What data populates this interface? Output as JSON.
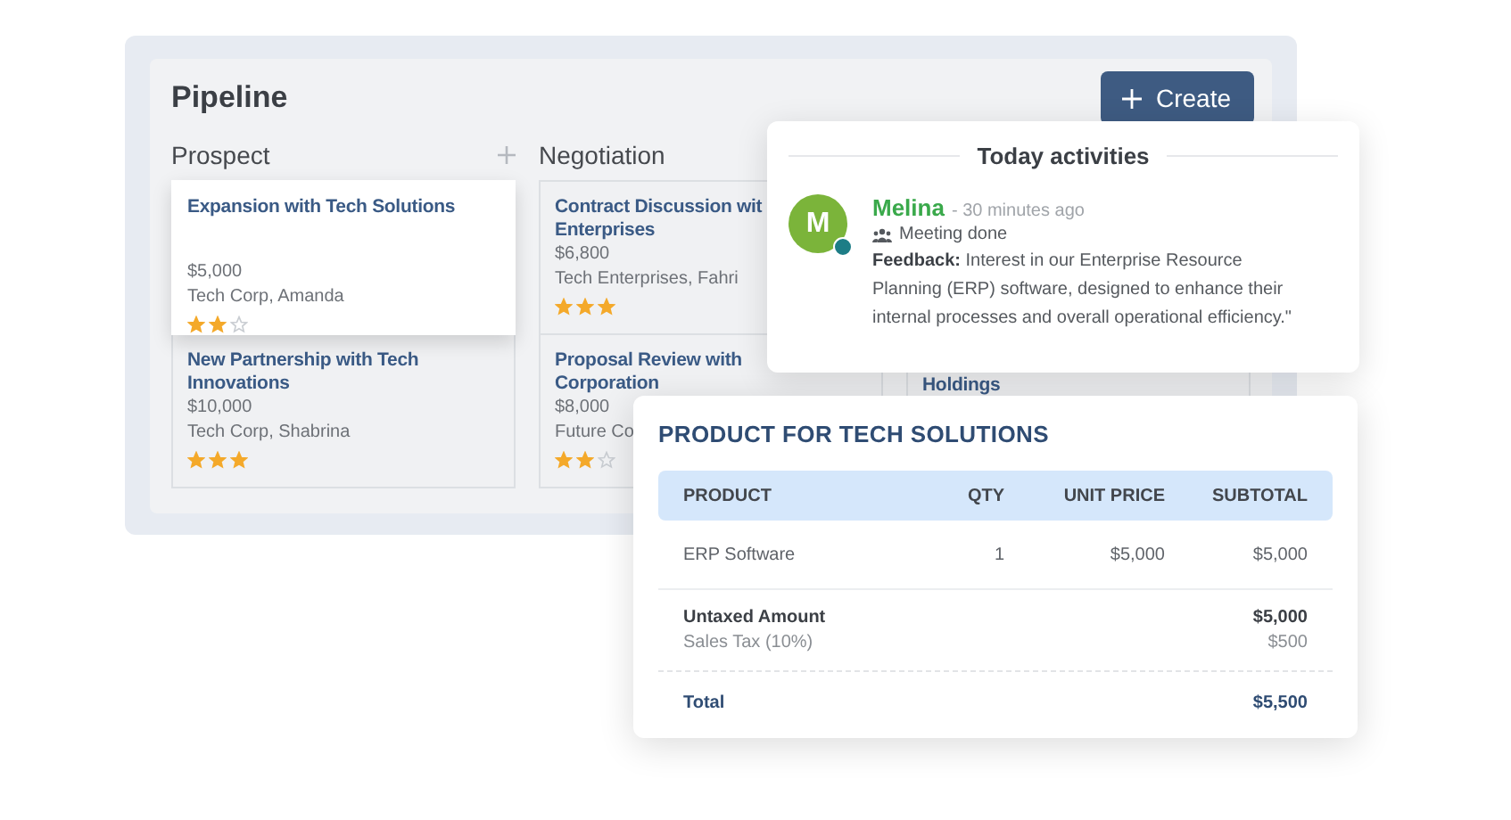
{
  "pipeline": {
    "title": "Pipeline",
    "create_button": "Create",
    "columns": [
      {
        "name": "Prospect",
        "add_icon": true,
        "cards": [
          {
            "title_lines": [
              "Expansion with Tech Solutions"
            ],
            "amount": "$5,000",
            "contact": "Tech Corp, Amanda",
            "stars": 2,
            "selected": true
          },
          {
            "title_lines": [
              "New Partnership with Tech",
              "Innovations"
            ],
            "amount": "$10,000",
            "contact": "Tech Corp, Shabrina",
            "stars": 3,
            "selected": false
          }
        ]
      },
      {
        "name": "Negotiation",
        "add_icon": false,
        "cards": [
          {
            "title_lines": [
              "Contract Discussion wit",
              "Enterprises"
            ],
            "amount": "$6,800",
            "contact": "Tech Enterprises, Fahri",
            "stars": 3,
            "selected": false
          },
          {
            "title_lines": [
              "Proposal Review with",
              "Corporation"
            ],
            "amount": "$8,000",
            "contact": "Future Co",
            "stars": 2,
            "selected": false
          }
        ]
      },
      {
        "cards": [
          {
            "title_lines": [
              "Holdings"
            ],
            "selected": false
          }
        ]
      }
    ]
  },
  "activities": {
    "title": "Today activities",
    "items": [
      {
        "initial": "M",
        "name": "Melina",
        "time": "- 30 minutes ago",
        "online": true,
        "action": "Meeting done",
        "feedback": "**Feedback:** Interest in our Enterprise Resource Planning (ERP) software, designed to enhance their internal processes and overall operational efficiency.\""
      }
    ]
  },
  "product": {
    "title": "PRODUCT FOR TECH SOLUTIONS",
    "columns": [
      "PRODUCT",
      "QTY",
      "UNIT PRICE",
      "SUBTOTAL"
    ],
    "rows": [
      [
        "ERP Software",
        "1",
        "$5,000",
        "$5,000"
      ]
    ],
    "summary": [
      {
        "kind": "subtotal",
        "label": "Untaxed Amount",
        "value": "$5,000"
      },
      {
        "kind": "tax",
        "label": "Sales Tax (10%)",
        "value": "$500"
      },
      {
        "kind": "total",
        "label": "Total",
        "value": "$5,500"
      }
    ]
  }
}
